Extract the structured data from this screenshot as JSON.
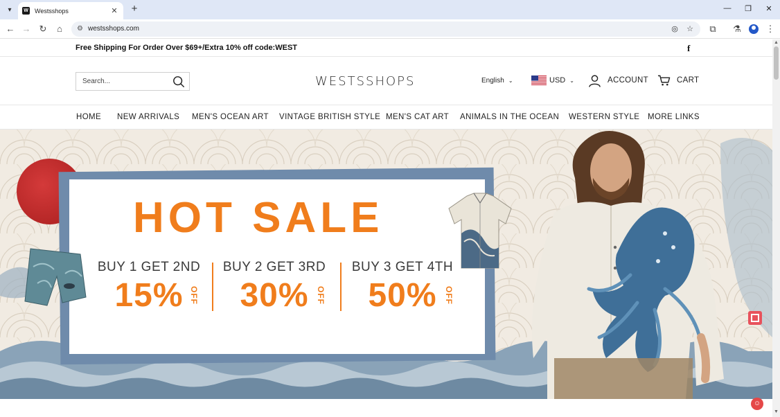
{
  "browser": {
    "tab_title": "Westsshops",
    "favicon_letter": "W",
    "url": "westsshops.com",
    "icons": [
      "tab-list-icon",
      "close-icon",
      "new-tab-icon",
      "minimize-icon",
      "restore-icon",
      "window-close-icon",
      "back-icon",
      "forward-icon",
      "reload-icon",
      "home-icon",
      "site-info-icon",
      "eye-off-icon",
      "star-icon",
      "extensions-icon",
      "lab-icon",
      "profile-icon",
      "kebab-menu-icon"
    ]
  },
  "announcement": {
    "text": "Free Shipping For Order Over $69+/Extra 10% off code:WEST",
    "social_icon": "facebook-icon"
  },
  "header": {
    "search_placeholder": "Search...",
    "logo": "WESTSSHOPS",
    "language": "English",
    "currency": "USD",
    "account": "ACCOUNT",
    "cart": "CART"
  },
  "nav": {
    "items": [
      "HOME",
      "NEW ARRIVALS",
      "MEN'S OCEAN ART",
      "VINTAGE BRITISH STYLE",
      "MEN'S CAT ART",
      "ANIMALS IN THE OCEAN",
      "WESTERN STYLE",
      "MORE LINKS"
    ]
  },
  "banner": {
    "headline": "HOT SALE",
    "deals": [
      {
        "title": "BUY 1 GET 2ND",
        "percent": "15%",
        "off": "OFF"
      },
      {
        "title": "BUY 2 GET 3RD",
        "percent": "30%",
        "off": "OFF"
      },
      {
        "title": "BUY 3 GET 4TH",
        "percent": "50%",
        "off": "OFF"
      }
    ]
  },
  "colors": {
    "accent_orange": "#f07d1c",
    "frame_blue": "#6f8bab",
    "chrome_bg": "#dfe7f6"
  }
}
